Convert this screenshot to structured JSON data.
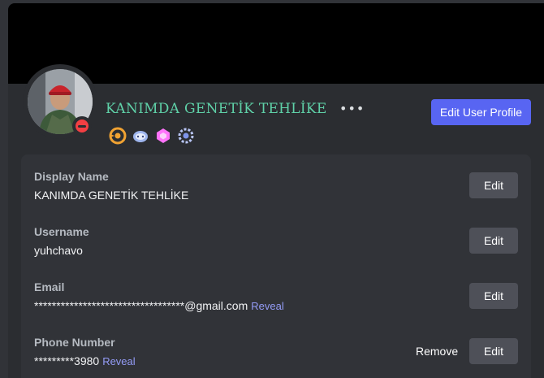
{
  "profile": {
    "display_name": "KANIMDA GENETİK TEHLİKE",
    "more_label": "•••",
    "edit_profile_label": "Edit User Profile",
    "status": "do-not-disturb",
    "badges": [
      "hypesquad-icon",
      "quest-icon",
      "nitro-gem-icon",
      "server-boost-icon"
    ]
  },
  "account": {
    "fields": [
      {
        "label": "Display Name",
        "value": "KANIMDA GENETİK TEHLİKE",
        "action": "Edit"
      },
      {
        "label": "Username",
        "value": "yuhchavo",
        "action": "Edit"
      },
      {
        "label": "Email",
        "value": "**********************************@gmail.com",
        "reveal": "Reveal",
        "action": "Edit"
      },
      {
        "label": "Phone Number",
        "value": "*********3980",
        "reveal": "Reveal",
        "remove": "Remove",
        "action": "Edit"
      }
    ]
  },
  "colors": {
    "accent": "#5865f2",
    "display_name": "#5fd1a8",
    "dnd": "#f23f43",
    "link": "#949cf7"
  }
}
